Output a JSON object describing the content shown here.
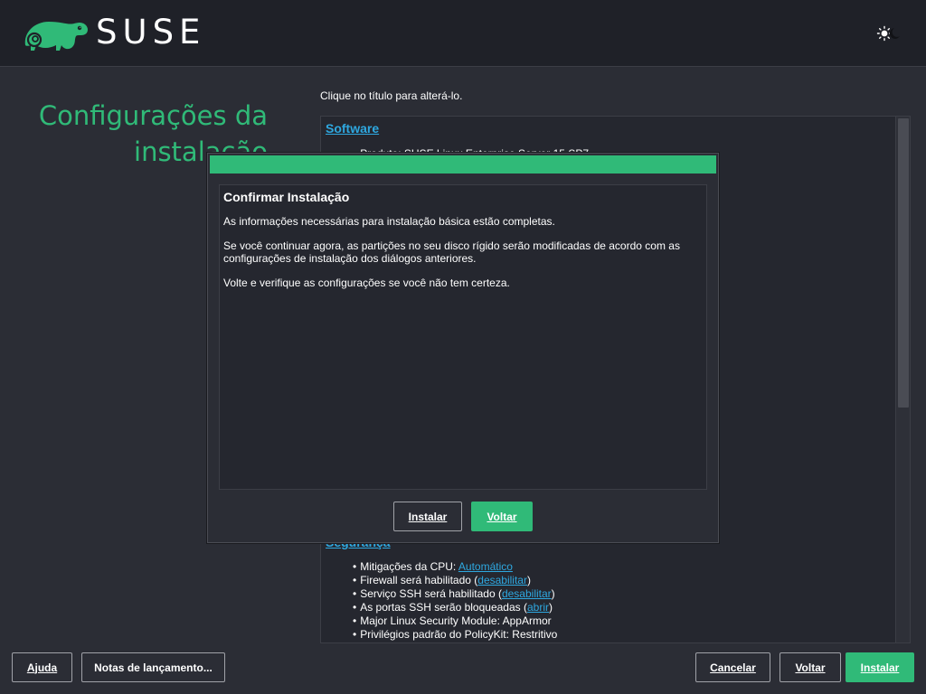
{
  "header": {
    "brand": "SUSE",
    "logo_icon": "chameleon-logo-icon",
    "theme_icon": "theme-toggle-icon"
  },
  "page": {
    "title_line1": "Configurações da",
    "title_line2": "instalação",
    "hint": "Clique no título para alterá-lo."
  },
  "summary": {
    "software_link": "Software",
    "software_items": [
      "Produto: SUSE Linux Enterprise Server 15 SP7"
    ],
    "security_link": "Segurança",
    "security_items": [
      {
        "prefix": "Mitigações da CPU: ",
        "link": "Automático",
        "suffix": ""
      },
      {
        "prefix": "Firewall será habilitado (",
        "link": "desabilitar",
        "suffix": ")"
      },
      {
        "prefix": "Serviço SSH será habilitado (",
        "link": "desabilitar",
        "suffix": ")"
      },
      {
        "prefix": "As portas SSH serão bloqueadas (",
        "link": "abrir",
        "suffix": ")"
      },
      {
        "prefix": "Major Linux Security Module: AppArmor",
        "link": "",
        "suffix": ""
      },
      {
        "prefix": "Privilégios padrão do PolicyKit: Restritivo",
        "link": "",
        "suffix": ""
      }
    ]
  },
  "dialog": {
    "heading": "Confirmar Instalação",
    "paragraphs": [
      "As informações necessárias para instalação básica estão completas.",
      "Se você continuar agora, as partições no seu disco rígido serão modificadas de acordo com as configurações de instalação dos diálogos anteriores.",
      "Volte e verifique as configurações se você não tem certeza."
    ],
    "install_label": "Instalar",
    "back_label": "Voltar"
  },
  "bottom": {
    "help_label": "Ajuda",
    "release_notes_label": "Notas de lançamento...",
    "cancel_label": "Cancelar",
    "back_label": "Voltar",
    "install_label": "Instalar"
  },
  "colors": {
    "accent": "#30ba78",
    "link": "#2ea8e0",
    "background": "#2b2d35",
    "header": "#1f2128"
  }
}
